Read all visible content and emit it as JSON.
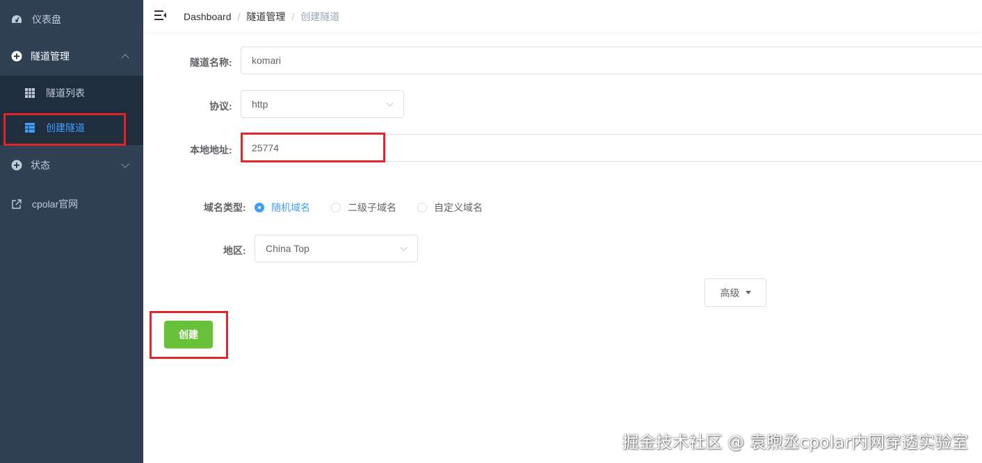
{
  "sidebar": {
    "items": [
      {
        "label": "仪表盘",
        "icon": "dashboard-icon"
      },
      {
        "label": "隧道管理",
        "icon": "tunnel-manage-icon"
      },
      {
        "label": "状态",
        "icon": "status-icon"
      },
      {
        "label": "cpolar官网",
        "icon": "external-link-icon"
      }
    ],
    "submenu": [
      {
        "label": "隧道列表",
        "icon": "grid-icon"
      },
      {
        "label": "创建隧道",
        "icon": "table-icon"
      }
    ],
    "colors": {
      "background": "#304156",
      "submenu_background": "#1f2d3d",
      "active": "#409eff"
    }
  },
  "header": {
    "breadcrumb": [
      "Dashboard",
      "隧道管理",
      "创建隧道"
    ],
    "separator": "/"
  },
  "form": {
    "tunnel_name_label": "隧道名称:",
    "tunnel_name_value": "komari",
    "protocol_label": "协议:",
    "protocol_value": "http",
    "local_address_label": "本地地址:",
    "local_address_value": "25774",
    "domain_type_label": "域名类型:",
    "domain_types": [
      {
        "label": "随机域名",
        "checked": true
      },
      {
        "label": "二级子域名",
        "checked": false
      },
      {
        "label": "自定义域名",
        "checked": false
      }
    ],
    "region_label": "地区:",
    "region_value": "China Top",
    "advanced_label": "高级",
    "create_label": "创建"
  },
  "watermark": "掘金技术社区 @ 袁煦丞cpolar内网穿透实验室",
  "colors": {
    "primary": "#409eff",
    "success": "#67c23a",
    "highlight": "#e0262a"
  }
}
